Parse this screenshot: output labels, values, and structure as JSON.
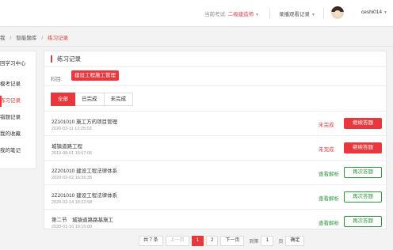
{
  "header": {
    "exam_label": "当前考试:",
    "exam_value": "二级建造师",
    "record_label": "录播观看记录",
    "username": "ceshi014"
  },
  "breadcrumb": {
    "item1": "我",
    "item2": "智能题库",
    "current": "练习记录"
  },
  "sidebar": {
    "title": "回学习中心",
    "items": [
      "模考记录",
      "练习记录",
      "错题记录",
      "我的收藏",
      "我的笔记"
    ]
  },
  "main": {
    "title": "练习记录",
    "subject_label": "科目:",
    "subject_value": "建设工程施工管理",
    "tabs": [
      "全部",
      "已完成",
      "未完成"
    ]
  },
  "records": [
    {
      "title": "2Z101010 施工方的项目管理",
      "date": "2020-03-11 12:25:03",
      "status": "未完成",
      "action": "继续答题"
    },
    {
      "title": "城镇道路工程",
      "date": "2019-08-01 15:57:06",
      "status": "未完成",
      "action": "继续答题"
    },
    {
      "title": "2Z201010 建设工程法律体系",
      "date": "2020-03-02 16:26:35",
      "status": "查看解析",
      "action": "再次答题"
    },
    {
      "title": "2Z201010 建设工程法律体系",
      "date": "2020-02-14 18:22:58",
      "status": "查看解析",
      "action": "再次答题"
    },
    {
      "title": "第二节　城镇道路路基施工",
      "date": "2020-01-16 10:15:00",
      "status": "查看解析",
      "action": "再次答题"
    }
  ],
  "pagination": {
    "total": "共 7 条",
    "prev": "上一页",
    "page1": "1",
    "page2": "2",
    "next": "下一页",
    "goto_label": "到第",
    "goto_value": "1",
    "page_suffix": "页",
    "confirm": "确定",
    "current_page": 1
  },
  "colors": {
    "accent": "#e8383d",
    "success": "#2b9a3c"
  }
}
